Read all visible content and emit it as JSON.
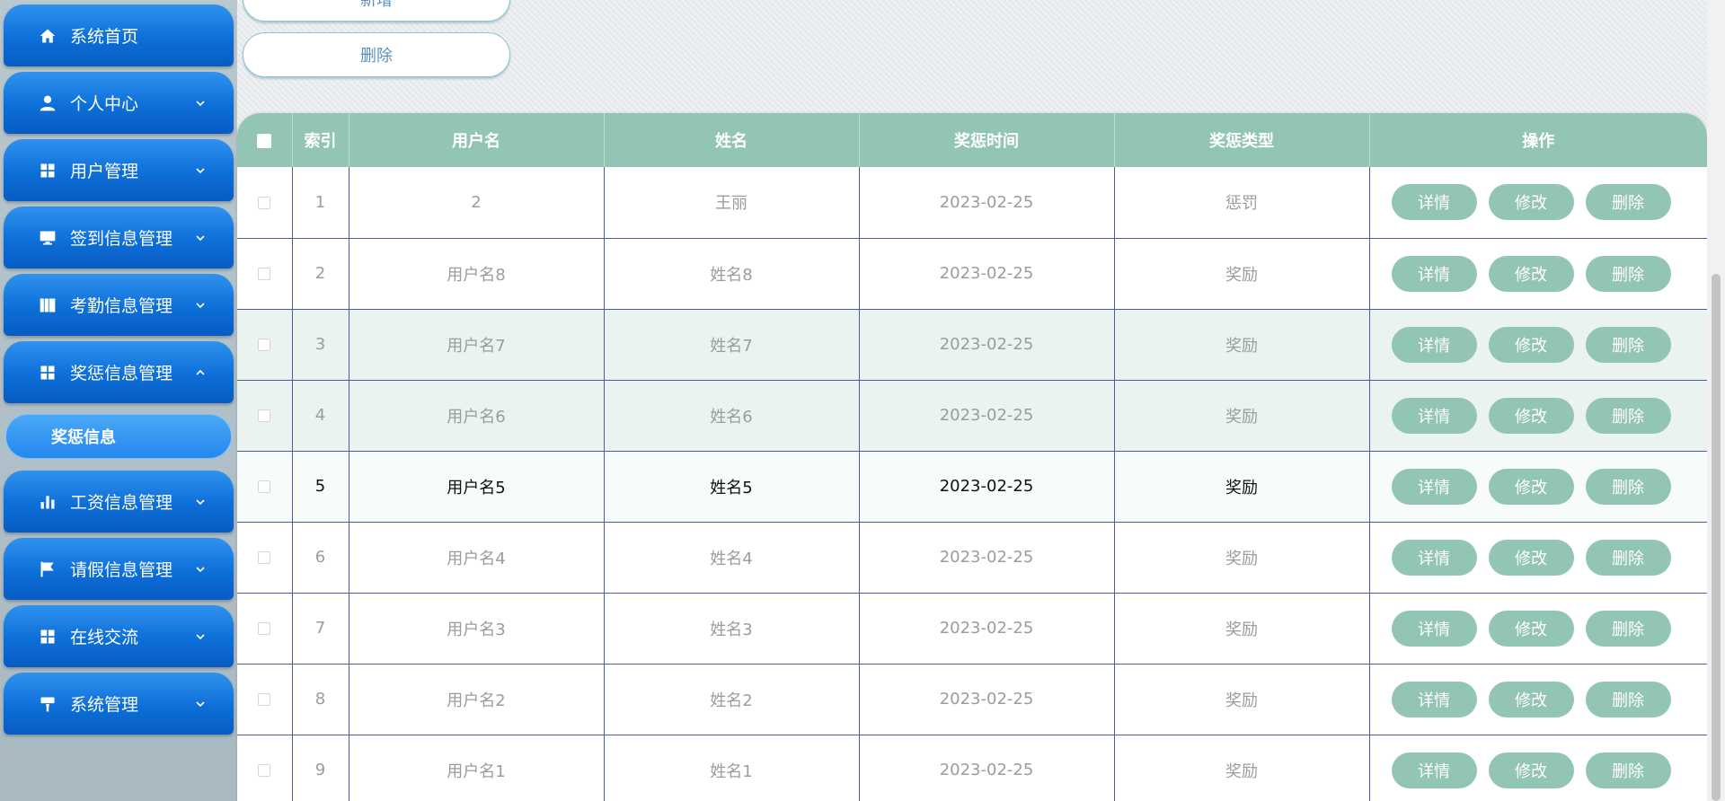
{
  "sidebar": {
    "items": [
      {
        "label": "系统首页",
        "icon": "home-icon",
        "has_arrow": false
      },
      {
        "label": "个人中心",
        "icon": "user-icon",
        "has_arrow": true,
        "arrow": "down"
      },
      {
        "label": "用户管理",
        "icon": "grid-icon",
        "has_arrow": true,
        "arrow": "down"
      },
      {
        "label": "签到信息管理",
        "icon": "monitor-icon",
        "has_arrow": true,
        "arrow": "down"
      },
      {
        "label": "考勤信息管理",
        "icon": "book-icon",
        "has_arrow": true,
        "arrow": "down"
      },
      {
        "label": "奖惩信息管理",
        "icon": "grid-icon",
        "has_arrow": true,
        "arrow": "up"
      },
      {
        "label": "工资信息管理",
        "icon": "bar-chart-icon",
        "has_arrow": true,
        "arrow": "down"
      },
      {
        "label": "请假信息管理",
        "icon": "flag-icon",
        "has_arrow": true,
        "arrow": "down"
      },
      {
        "label": "在线交流",
        "icon": "grid-icon",
        "has_arrow": true,
        "arrow": "down"
      },
      {
        "label": "系统管理",
        "icon": "paint-roller-icon",
        "has_arrow": true,
        "arrow": "down"
      }
    ],
    "submenu": {
      "label": "奖惩信息"
    }
  },
  "toolbar": {
    "add_label": "新增",
    "delete_label": "删除"
  },
  "table": {
    "columns": [
      "索引",
      "用户名",
      "姓名",
      "奖惩时间",
      "奖惩类型",
      "操作"
    ],
    "actions": {
      "detail": "详情",
      "edit": "修改",
      "delete": "删除"
    },
    "rows": [
      {
        "index": "1",
        "username": "2",
        "name": "王丽",
        "time": "2023-02-25",
        "type": "惩罚"
      },
      {
        "index": "2",
        "username": "用户名8",
        "name": "姓名8",
        "time": "2023-02-25",
        "type": "奖励"
      },
      {
        "index": "3",
        "username": "用户名7",
        "name": "姓名7",
        "time": "2023-02-25",
        "type": "奖励"
      },
      {
        "index": "4",
        "username": "用户名6",
        "name": "姓名6",
        "time": "2023-02-25",
        "type": "奖励"
      },
      {
        "index": "5",
        "username": "用户名5",
        "name": "姓名5",
        "time": "2023-02-25",
        "type": "奖励"
      },
      {
        "index": "6",
        "username": "用户名4",
        "name": "姓名4",
        "time": "2023-02-25",
        "type": "奖励"
      },
      {
        "index": "7",
        "username": "用户名3",
        "name": "姓名3",
        "time": "2023-02-25",
        "type": "奖励"
      },
      {
        "index": "8",
        "username": "用户名2",
        "name": "姓名2",
        "time": "2023-02-25",
        "type": "奖励"
      },
      {
        "index": "9",
        "username": "用户名1",
        "name": "姓名1",
        "time": "2023-02-25",
        "type": "奖励"
      }
    ]
  },
  "colors": {
    "sidebar_blue": "#0d6fd8",
    "table_header": "#93c5b4",
    "action_button": "#93c5b4"
  }
}
